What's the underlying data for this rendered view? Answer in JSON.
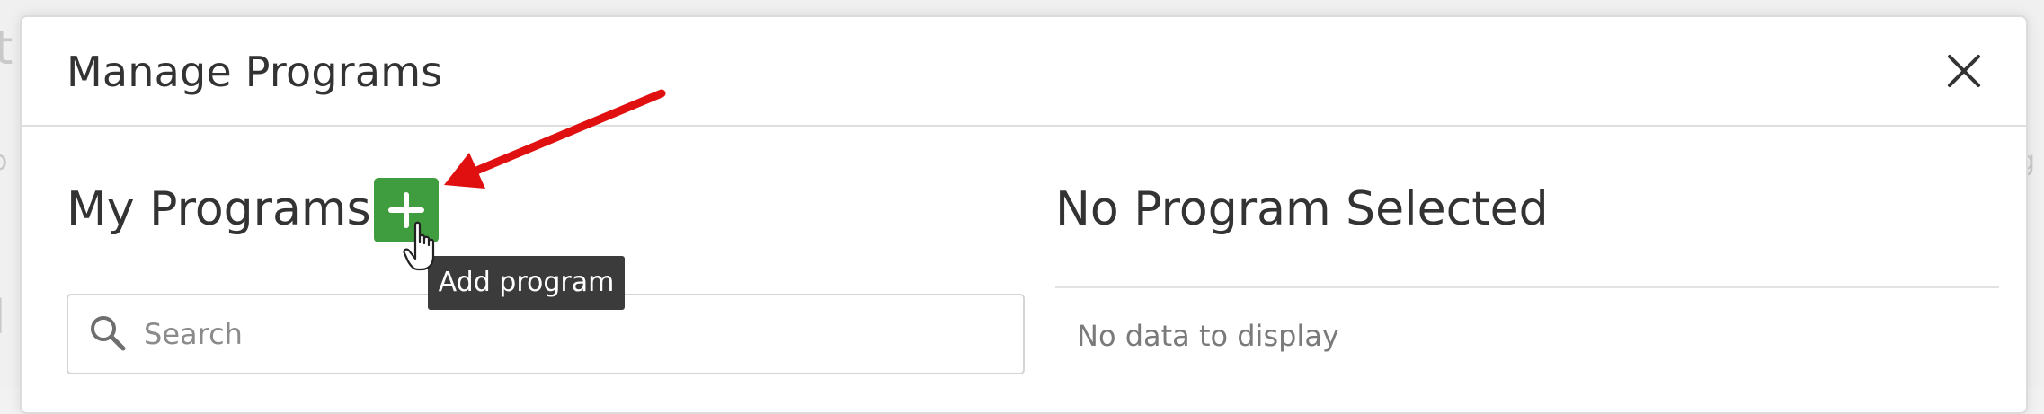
{
  "modal": {
    "title": "Manage Programs",
    "close_icon": "close-icon"
  },
  "left_panel": {
    "title": "My Programs",
    "add_button_icon": "plus-icon",
    "tooltip": "Add program",
    "search": {
      "placeholder": "Search",
      "value": ""
    }
  },
  "right_panel": {
    "title": "No Program Selected",
    "empty_message": "No data to display"
  },
  "colors": {
    "add_button": "#3f9d3f",
    "tooltip_bg": "#3b3b3b",
    "annotation_arrow": "#e01010"
  }
}
